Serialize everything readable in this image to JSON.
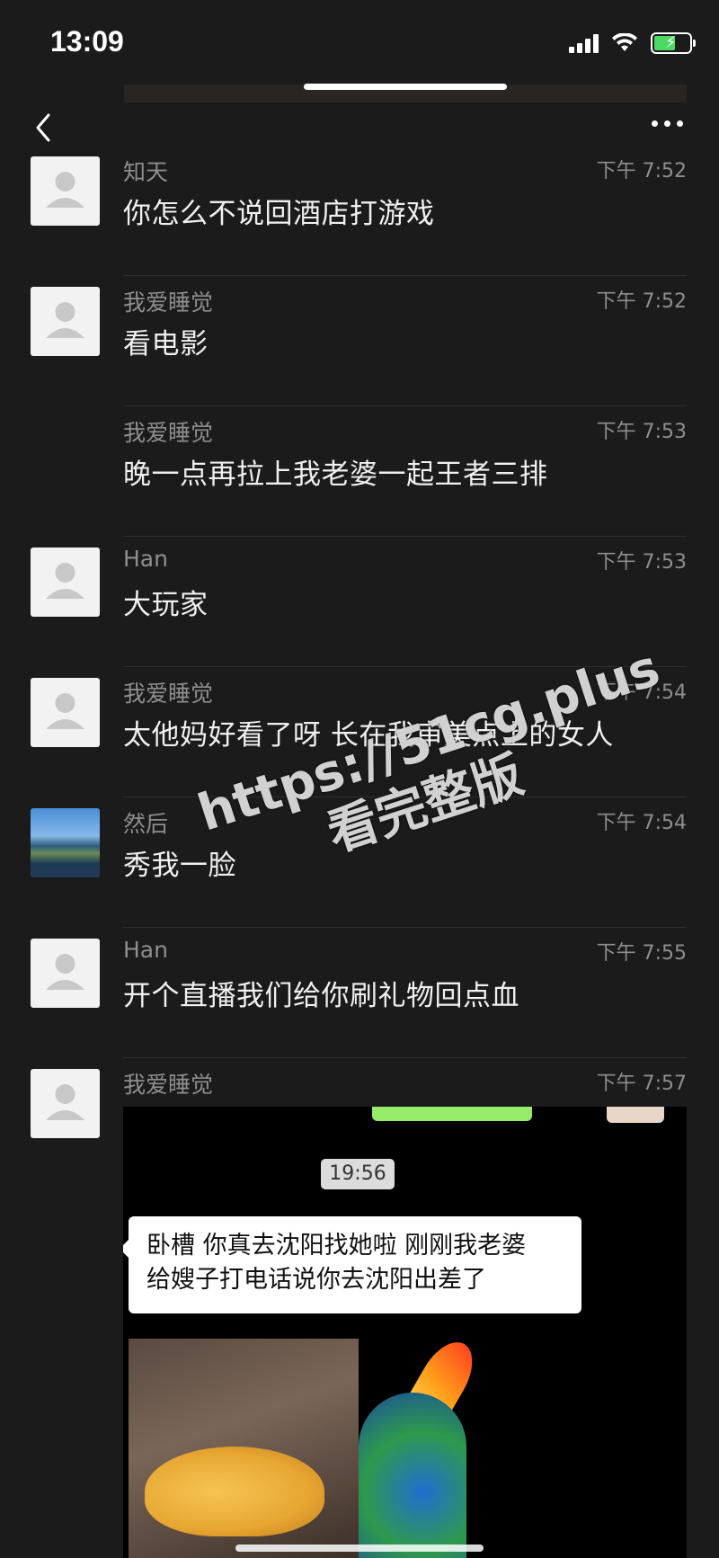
{
  "status_bar": {
    "time": "13:09"
  },
  "messages": [
    {
      "sender": "知天",
      "time": "下午 7:52",
      "text": "你怎么不说回酒店打游戏",
      "avatar": "default"
    },
    {
      "sender": "我爱睡觉",
      "time": "下午 7:52",
      "text": "看电影",
      "avatar": "default"
    },
    {
      "sender": "我爱睡觉",
      "time": "下午 7:53",
      "text": "晚一点再拉上我老婆一起王者三排",
      "avatar": "none"
    },
    {
      "sender": "Han",
      "time": "下午 7:53",
      "text": "大玩家",
      "avatar": "default"
    },
    {
      "sender": "我爱睡觉",
      "time": "下午 7:54",
      "text": "太他妈好看了呀 长在我审美点上的女人",
      "avatar": "default"
    },
    {
      "sender": "然后",
      "time": "下午 7:54",
      "text": "秀我一脸",
      "avatar": "photo"
    },
    {
      "sender": "Han",
      "time": "下午 7:55",
      "text": "开个直播我们给你刷礼物回点血",
      "avatar": "default"
    },
    {
      "sender": "我爱睡觉",
      "time": "下午 7:57",
      "text": "",
      "avatar": "default"
    }
  ],
  "embedded_screenshot": {
    "timestamp": "19:56",
    "bubble_line_1": "卧槽 你真去沈阳找她啦 刚刚我老婆",
    "bubble_line_2": "给嫂子打电话说你去沈阳出差了"
  },
  "watermark": {
    "line1": "https://51cg.plus",
    "line2": "看完整版"
  },
  "icons": {
    "back": "chevron-left-icon",
    "more": "more-dots-icon",
    "avatar": "default-user-icon"
  },
  "colors": {
    "background": "#1b1b1b",
    "bubble_green": "#95ec69"
  }
}
